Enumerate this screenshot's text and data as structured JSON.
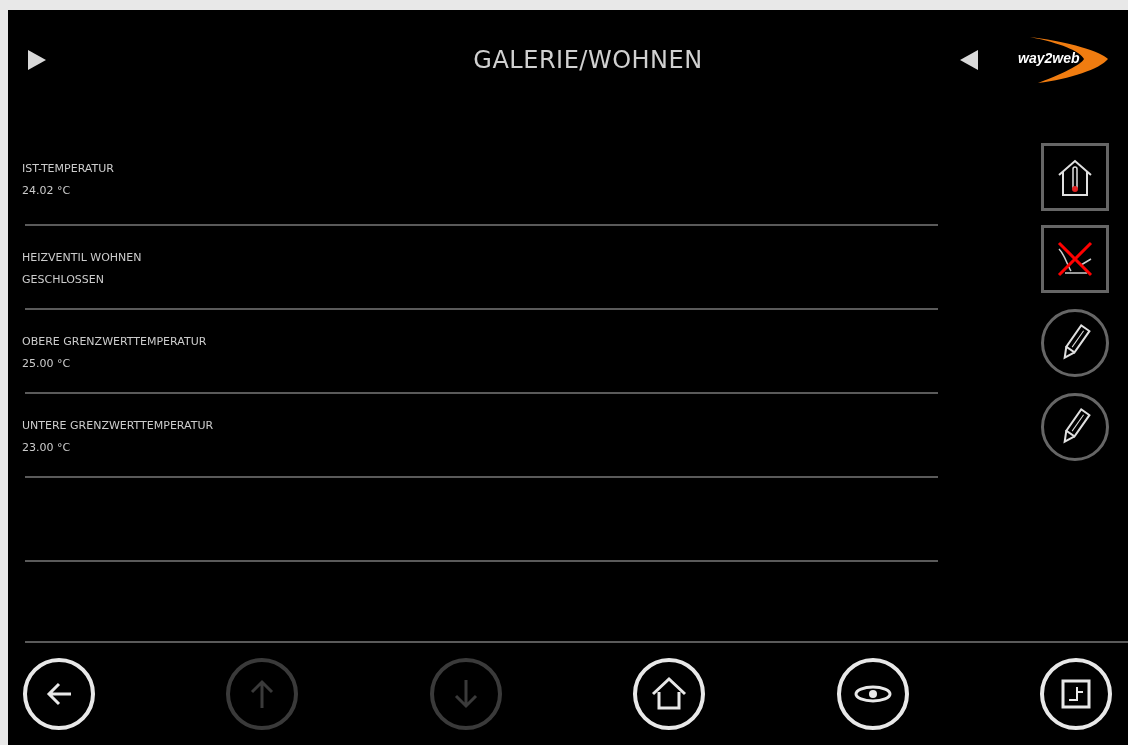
{
  "header": {
    "title": "GALERIE/WOHNEN",
    "logo": "way2web"
  },
  "rows": [
    {
      "label": "IST-TEMPERATUR",
      "value": "24.02 °C"
    },
    {
      "label": "HEIZVENTIL WOHNEN",
      "value": "GESCHLOSSEN"
    },
    {
      "label": "OBERE GRENZWERTTEMPERATUR",
      "value": "25.00 °C"
    },
    {
      "label": "UNTERE GRENZWERTTEMPERATUR",
      "value": "23.00 °C"
    }
  ],
  "side_actions": [
    {
      "kind": "thermometer"
    },
    {
      "kind": "heating-off"
    },
    {
      "kind": "edit"
    },
    {
      "kind": "edit"
    }
  ],
  "footer": [
    {
      "kind": "back",
      "disabled": false
    },
    {
      "kind": "up",
      "disabled": true
    },
    {
      "kind": "down",
      "disabled": true
    },
    {
      "kind": "home",
      "disabled": false
    },
    {
      "kind": "view",
      "disabled": false
    },
    {
      "kind": "floorplan",
      "disabled": false
    }
  ]
}
